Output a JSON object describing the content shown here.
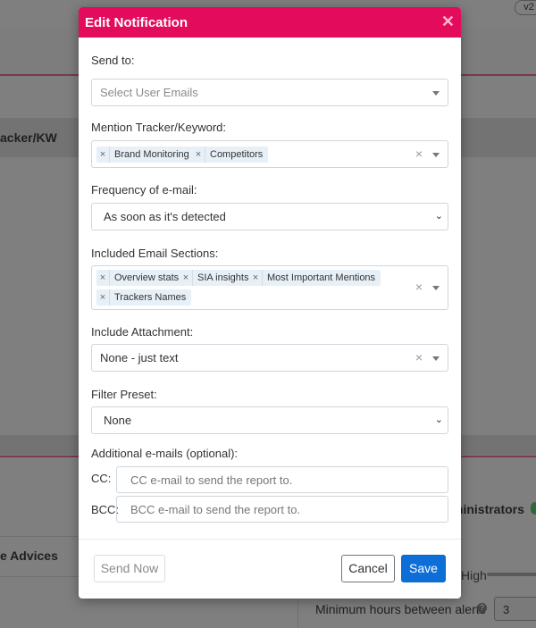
{
  "background": {
    "version_badge": "v2",
    "kw_header": "acker/KW",
    "administrators": "ministrators",
    "advices": "e Advices",
    "slider_label": "High",
    "min_hours_label": "Minimum hours between alerts",
    "min_hours_value": "3"
  },
  "modal": {
    "title": "Edit Notification",
    "close_icon": "close-icon",
    "send_to": {
      "label": "Send to:",
      "placeholder": "Select User Emails"
    },
    "mention": {
      "label": "Mention Tracker/Keyword:",
      "tags": [
        "Brand Monitoring",
        "Competitors"
      ]
    },
    "frequency": {
      "label": "Frequency of e-mail:",
      "value": "As soon as it's detected"
    },
    "sections": {
      "label": "Included Email Sections:",
      "tags": [
        "Overview stats",
        "SIA insights",
        "Most Important Mentions",
        "Trackers Names"
      ]
    },
    "attachment": {
      "label": "Include Attachment:",
      "value": "None - just text"
    },
    "filter": {
      "label": "Filter Preset:",
      "value": "None"
    },
    "additional": {
      "label": "Additional e-mails (optional):",
      "cc_label": "CC:",
      "cc_placeholder": "CC e-mail to send the report to.",
      "bcc_label": "BCC:",
      "bcc_placeholder": "BCC e-mail to send the report to."
    },
    "buttons": {
      "send_now": "Send Now",
      "cancel": "Cancel",
      "save": "Save"
    }
  },
  "colors": {
    "header": "#e30b5c",
    "save": "#0d6ed8"
  }
}
